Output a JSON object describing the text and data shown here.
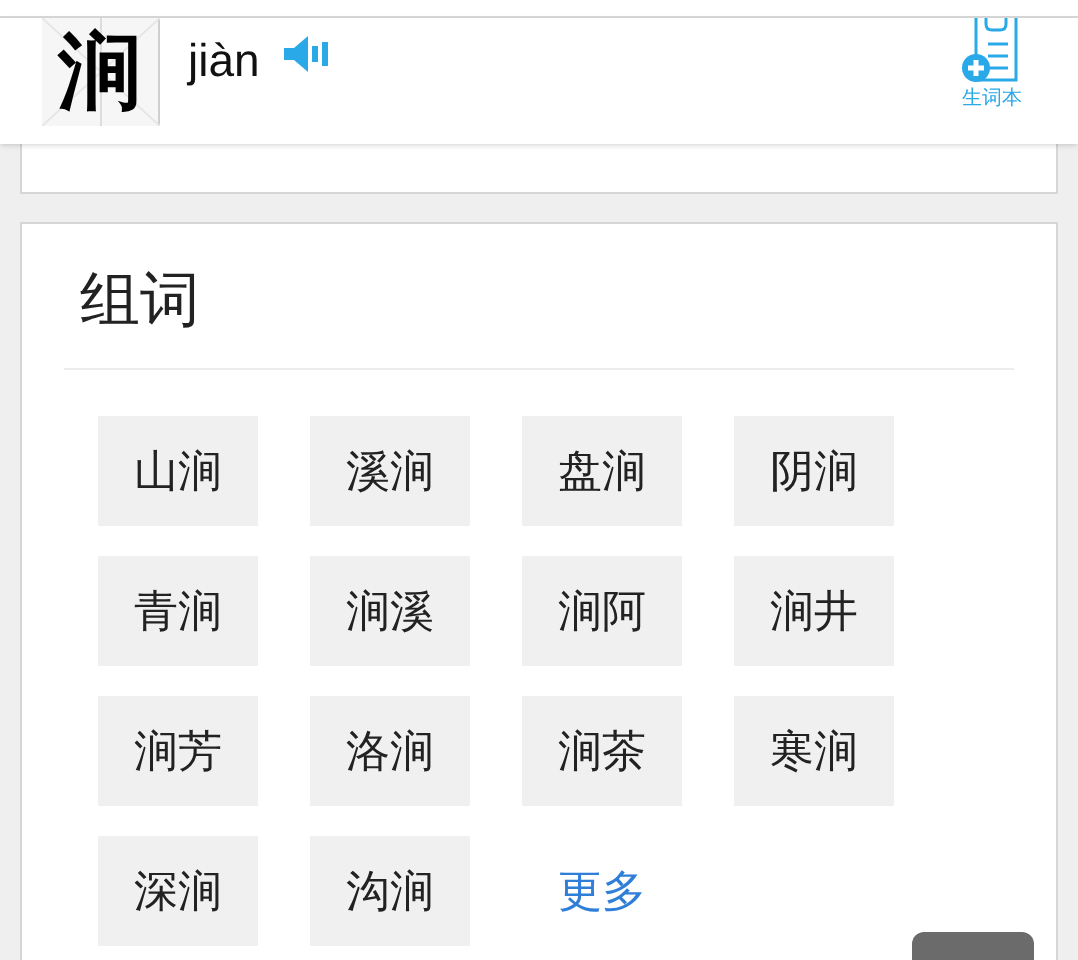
{
  "header": {
    "character": "涧",
    "pinyin": "jiàn",
    "wordbook_label": "生词本"
  },
  "words_section": {
    "title": "组词",
    "words": [
      {
        "kind": "word",
        "text": "山涧"
      },
      {
        "kind": "word",
        "text": "溪涧"
      },
      {
        "kind": "word",
        "text": "盘涧"
      },
      {
        "kind": "word",
        "text": "阴涧"
      },
      {
        "kind": "word",
        "text": "青涧"
      },
      {
        "kind": "word",
        "text": "涧溪"
      },
      {
        "kind": "word",
        "text": "涧阿"
      },
      {
        "kind": "word",
        "text": "涧井"
      },
      {
        "kind": "word",
        "text": "涧芳"
      },
      {
        "kind": "word",
        "text": "洛涧"
      },
      {
        "kind": "word",
        "text": "涧茶"
      },
      {
        "kind": "word",
        "text": "寒涧"
      },
      {
        "kind": "word",
        "text": "深涧"
      },
      {
        "kind": "word",
        "text": "沟涧"
      },
      {
        "kind": "more",
        "text": "更多"
      }
    ]
  }
}
